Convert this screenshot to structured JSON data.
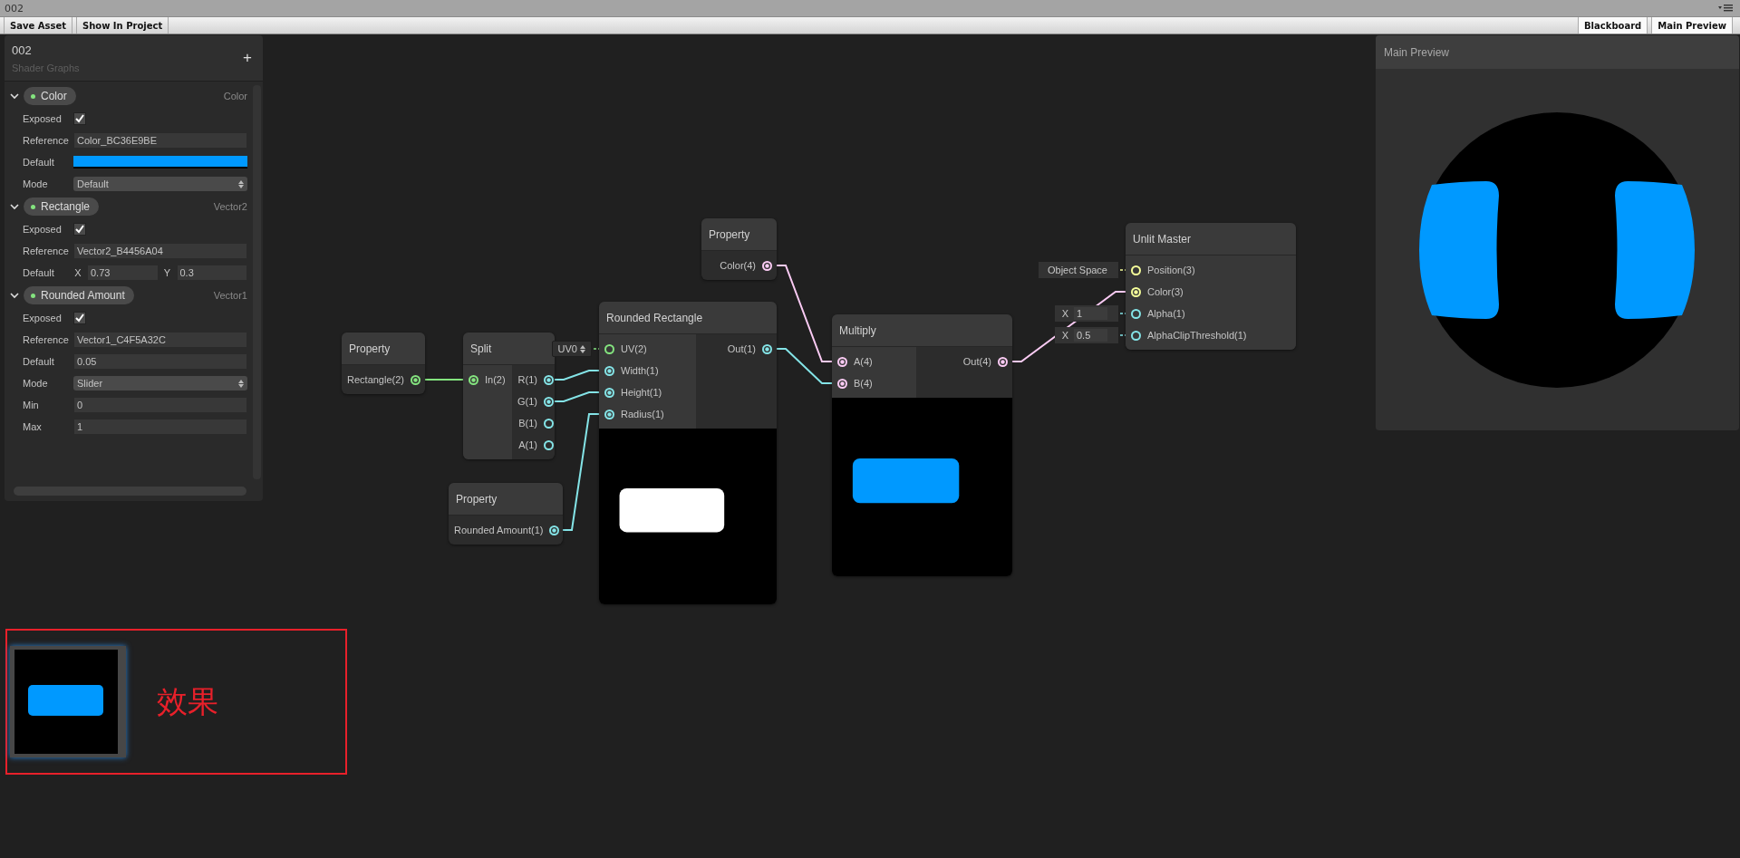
{
  "window": {
    "title": "002"
  },
  "toolbar": {
    "buttons": [
      "Save Asset",
      "Show In Project"
    ],
    "toggles": [
      "Blackboard",
      "Main Preview"
    ]
  },
  "blackboard": {
    "title": "002",
    "subtitle": "Shader Graphs",
    "add_button": "+",
    "properties": [
      {
        "name": "Color",
        "type": "Color",
        "expanded": true,
        "fields": [
          {
            "kind": "checkbox",
            "label": "Exposed",
            "checked": true
          },
          {
            "kind": "text",
            "label": "Reference",
            "value": "Color_BC36E9BE"
          },
          {
            "kind": "color",
            "label": "Default",
            "color": "#0099ff"
          },
          {
            "kind": "dropdown",
            "label": "Mode",
            "value": "Default"
          }
        ]
      },
      {
        "name": "Rectangle",
        "type": "Vector2",
        "expanded": true,
        "fields": [
          {
            "kind": "checkbox",
            "label": "Exposed",
            "checked": true
          },
          {
            "kind": "text",
            "label": "Reference",
            "value": "Vector2_B4456A04"
          },
          {
            "kind": "vector",
            "label": "Default",
            "components": [
              {
                "axis": "X",
                "value": "0.73"
              },
              {
                "axis": "Y",
                "value": "0.3"
              }
            ]
          }
        ]
      },
      {
        "name": "Rounded Amount",
        "type": "Vector1",
        "expanded": true,
        "fields": [
          {
            "kind": "checkbox",
            "label": "Exposed",
            "checked": true
          },
          {
            "kind": "text",
            "label": "Reference",
            "value": "Vector1_C4F5A32C"
          },
          {
            "kind": "text",
            "label": "Default",
            "value": "0.05"
          },
          {
            "kind": "dropdown",
            "label": "Mode",
            "value": "Slider"
          },
          {
            "kind": "text",
            "label": "Min",
            "value": "0"
          },
          {
            "kind": "text",
            "label": "Max",
            "value": "1"
          }
        ]
      }
    ]
  },
  "nodes": [
    {
      "title": "Property",
      "outputs": [
        {
          "label": "Rectangle(2)",
          "color": "#84e47f",
          "connected": true
        }
      ]
    },
    {
      "title": "Split",
      "inputs": [
        {
          "label": "In(2)",
          "color": "#84e47f",
          "connected": true
        }
      ],
      "outputs": [
        {
          "label": "R(1)",
          "color": "#84e4e7",
          "connected": true
        },
        {
          "label": "G(1)",
          "color": "#84e4e7",
          "connected": true
        },
        {
          "label": "B(1)",
          "color": "#84e4e7",
          "connected": false
        },
        {
          "label": "A(1)",
          "color": "#84e4e7",
          "connected": false
        }
      ]
    },
    {
      "title": "Property",
      "outputs": [
        {
          "label": "Rounded Amount(1)",
          "color": "#84e4e7",
          "connected": true
        }
      ]
    },
    {
      "title": "Property",
      "outputs": [
        {
          "label": "Color(4)",
          "color": "#fbcbf4",
          "connected": true
        }
      ]
    },
    {
      "title": "Rounded Rectangle",
      "inputs": [
        {
          "label": "UV(2)",
          "color": "#84e47f",
          "connected": false,
          "default": {
            "kind": "dropdown",
            "value": "UV0"
          }
        },
        {
          "label": "Width(1)",
          "color": "#84e4e7",
          "connected": true
        },
        {
          "label": "Height(1)",
          "color": "#84e4e7",
          "connected": true
        },
        {
          "label": "Radius(1)",
          "color": "#84e4e7",
          "connected": true
        }
      ],
      "outputs": [
        {
          "label": "Out(1)",
          "color": "#84e4e7",
          "connected": true
        }
      ],
      "preview": {
        "color": "#ffffff"
      }
    },
    {
      "title": "Multiply",
      "inputs": [
        {
          "label": "A(4)",
          "color": "#fbcbf4",
          "connected": true
        },
        {
          "label": "B(4)",
          "color": "#fbcbf4",
          "connected": true
        }
      ],
      "outputs": [
        {
          "label": "Out(4)",
          "color": "#fbcbf4",
          "connected": true
        }
      ],
      "preview": {
        "color": "#0099ff"
      }
    },
    {
      "title": "Unlit Master",
      "inputs": [
        {
          "label": "Position(3)",
          "color": "#f6ff9a",
          "connected": false,
          "default": {
            "kind": "label",
            "value": "Object Space"
          }
        },
        {
          "label": "Color(3)",
          "color": "#f6ff9a",
          "connected": true
        },
        {
          "label": "Alpha(1)",
          "color": "#84e4e7",
          "connected": false,
          "default": {
            "kind": "vector1",
            "axis": "X",
            "value": "1"
          }
        },
        {
          "label": "AlphaClipThreshold(1)",
          "color": "#84e4e7",
          "connected": false,
          "default": {
            "kind": "vector1",
            "axis": "X",
            "value": "0.5"
          }
        }
      ]
    }
  ],
  "main_preview": {
    "title": "Main Preview"
  },
  "annotation": {
    "label": "效果"
  }
}
